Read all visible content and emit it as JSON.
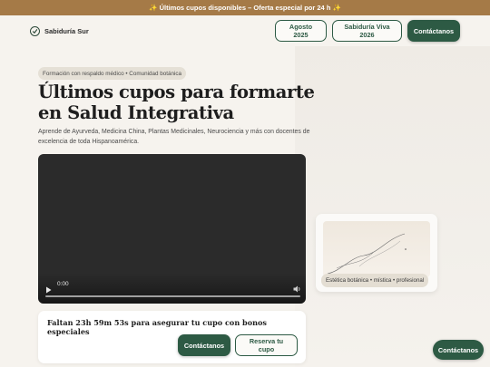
{
  "promo": {
    "text": "✨ Últimos cupos disponibles – Oferta especial por 24 h ✨"
  },
  "brand": {
    "name": "Sabiduría Sur",
    "logo_icon": "leaf-check-icon"
  },
  "nav": {
    "buttons": [
      {
        "label": "Agosto 2025"
      },
      {
        "label": "Sabiduría Viva 2026"
      }
    ],
    "contact_label": "Contáctanos"
  },
  "hero": {
    "badge": "Formación con respaldo médico • Comunidad botánica",
    "title": "Últimos cupos para formarte en Salud Integrativa",
    "description": "Aprende de Ayurveda, Medicina China, Plantas Medicinales, Neurociencia y más con docentes de excelencia de toda Hispanoamérica."
  },
  "video": {
    "time": "0:00"
  },
  "side_card": {
    "tag": "Estética botánica • mística • profesional"
  },
  "countdown": {
    "text": "Faltan 23h 59m 53s para asegurar tu cupo con bonos especiales",
    "contact_label": "Contáctanos",
    "reserve_label": "Reserva tu cupo"
  },
  "floating": {
    "contact_label": "Contáctanos"
  },
  "colors": {
    "promo_bar": "#a57a47",
    "brand_green": "#2d5a44",
    "background": "#f6f3ee"
  }
}
